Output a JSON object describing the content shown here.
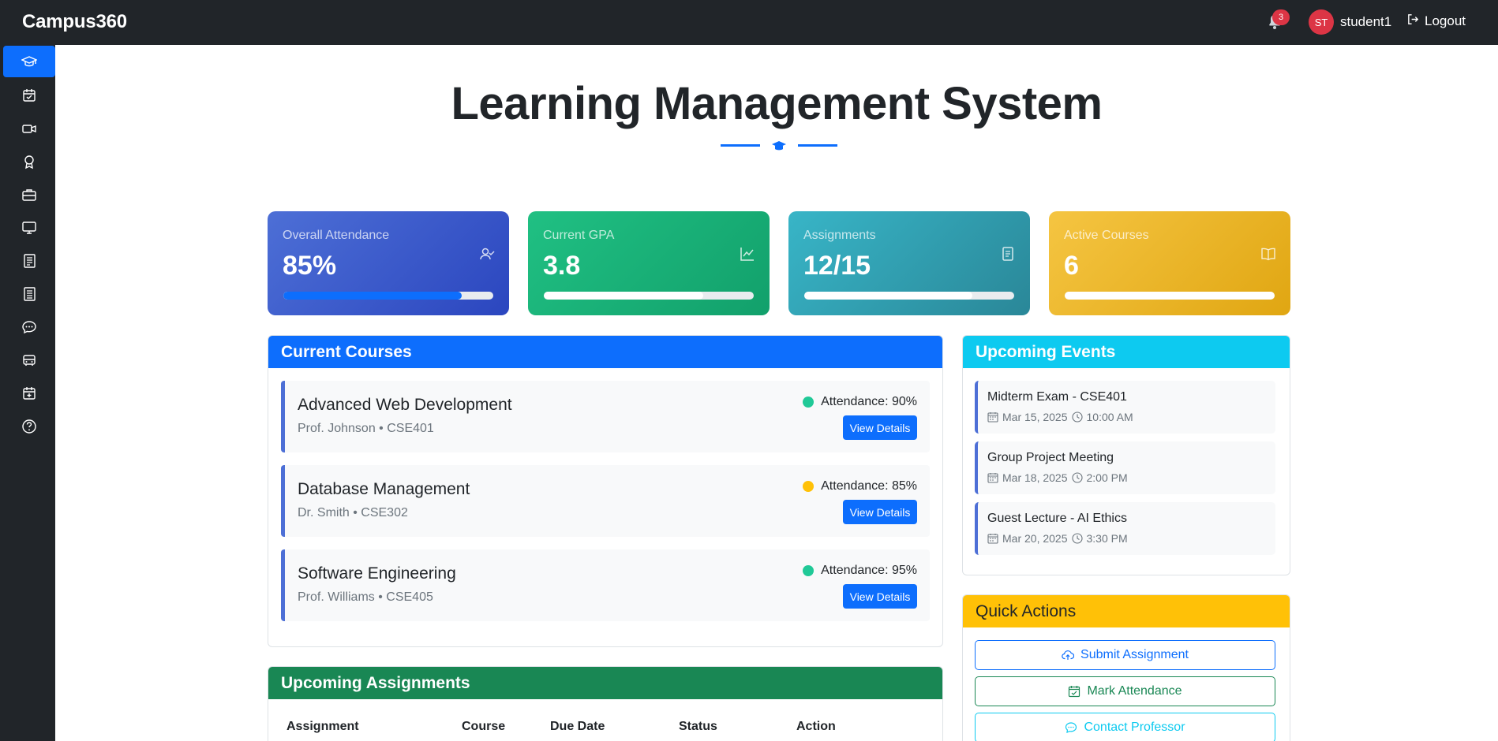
{
  "navbar": {
    "brand": "Campus360",
    "notification_count": "3",
    "avatar_initials": "ST",
    "username": "student1",
    "logout_label": "Logout"
  },
  "sidebar": {
    "items": [
      {
        "icon": "graduation-cap-icon",
        "active": true
      },
      {
        "icon": "calendar-check-icon"
      },
      {
        "icon": "video-camera-icon"
      },
      {
        "icon": "award-icon"
      },
      {
        "icon": "briefcase-icon"
      },
      {
        "icon": "monitor-icon"
      },
      {
        "icon": "document-icon"
      },
      {
        "icon": "document-list-icon"
      },
      {
        "icon": "chat-icon"
      },
      {
        "icon": "bus-icon"
      },
      {
        "icon": "calendar-plus-icon"
      },
      {
        "icon": "help-circle-icon"
      }
    ]
  },
  "header": {
    "title": "Learning Management System"
  },
  "stats": [
    {
      "label": "Overall Attendance",
      "value": "85%",
      "icon": "user-check-icon",
      "progress": 0.85,
      "colors": [
        "#4d6fd6",
        "#2b46bf"
      ],
      "fill": "#0d6efd"
    },
    {
      "label": "Current GPA",
      "value": "3.8",
      "icon": "chart-line-icon",
      "progress": 0.76,
      "colors": [
        "#20c083",
        "#12a06b"
      ],
      "fill": "#ffffff"
    },
    {
      "label": "Assignments",
      "value": "12/15",
      "icon": "file-text-icon",
      "progress": 0.8,
      "colors": [
        "#38b5c7",
        "#2a8798"
      ],
      "fill": "#ffffff"
    },
    {
      "label": "Active Courses",
      "value": "6",
      "icon": "book-open-icon",
      "progress": 1.0,
      "colors": [
        "#f5c542",
        "#e0a612"
      ],
      "fill": "#ffffff"
    }
  ],
  "courses_panel": {
    "title": "Current Courses",
    "header_color": "#0d6efd",
    "courses": [
      {
        "name": "Advanced Web Development",
        "meta": "Prof. Johnson • CSE401",
        "attendance": "Attendance: 90%",
        "dot_color": "#20c997",
        "button": "View Details"
      },
      {
        "name": "Database Management",
        "meta": "Dr. Smith • CSE302",
        "attendance": "Attendance: 85%",
        "dot_color": "#ffc107",
        "button": "View Details"
      },
      {
        "name": "Software Engineering",
        "meta": "Prof. Williams • CSE405",
        "attendance": "Attendance: 95%",
        "dot_color": "#20c997",
        "button": "View Details"
      }
    ]
  },
  "events_panel": {
    "title": "Upcoming Events",
    "header_color": "#0dcaf0",
    "events": [
      {
        "title": "Midterm Exam - CSE401",
        "date": "Mar 15, 2025",
        "time": "10:00 AM"
      },
      {
        "title": "Group Project Meeting",
        "date": "Mar 18, 2025",
        "time": "2:00 PM"
      },
      {
        "title": "Guest Lecture - AI Ethics",
        "date": "Mar 20, 2025",
        "time": "3:30 PM"
      }
    ]
  },
  "quick_actions": {
    "title": "Quick Actions",
    "header_color": "#ffc107",
    "actions": [
      {
        "label": "Submit Assignment",
        "icon": "cloud-upload-icon",
        "color": "#0d6efd"
      },
      {
        "label": "Mark Attendance",
        "icon": "calendar-check-icon",
        "color": "#198754"
      },
      {
        "label": "Contact Professor",
        "icon": "chat-icon",
        "color": "#0dcaf0"
      }
    ]
  },
  "assignments_panel": {
    "title": "Upcoming Assignments",
    "header_color": "#198754",
    "columns": [
      "Assignment",
      "Course",
      "Due Date",
      "Status",
      "Action"
    ]
  }
}
